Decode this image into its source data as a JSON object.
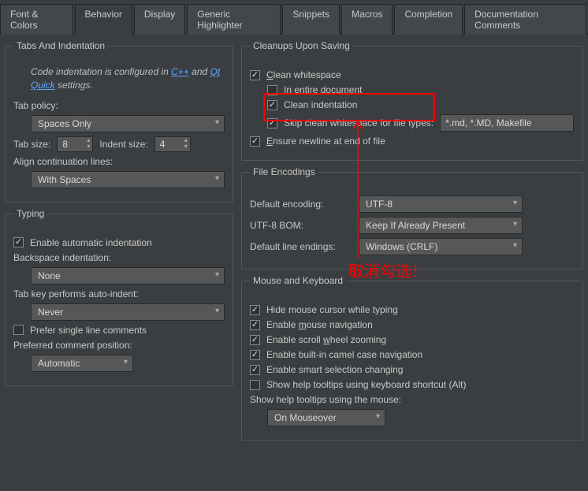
{
  "tabs": {
    "font_colors": "Font & Colors",
    "behavior": "Behavior",
    "display": "Display",
    "generic_highlighter": "Generic Highlighter",
    "snippets": "Snippets",
    "macros": "Macros",
    "completion": "Completion",
    "doc_comments": "Documentation Comments"
  },
  "groups": {
    "tabs_indent": {
      "title": "Tabs And Indentation",
      "hint_prefix": "Code indentation is configured in ",
      "hint_link1": "C++",
      "hint_mid": " and ",
      "hint_link2": "Qt Quick",
      "hint_suffix": " settings.",
      "tab_policy_label": "Tab policy:",
      "tab_policy_value": "Spaces Only",
      "tab_size_label": "Tab size:",
      "tab_size_value": "8",
      "indent_size_label": "Indent size:",
      "indent_size_value": "4",
      "align_label": "Align continuation lines:",
      "align_value": "With Spaces"
    },
    "typing": {
      "title": "Typing",
      "auto_indent": "Enable automatic indentation",
      "backspace_label": "Backspace indentation:",
      "backspace_value": "None",
      "tabkey_label": "Tab key performs auto-indent:",
      "tabkey_value": "Never",
      "singleline": "Prefer single line comments",
      "commentpos_label": "Preferred comment position:",
      "commentpos_value": "Automatic"
    },
    "cleanups": {
      "title": "Cleanups Upon Saving",
      "clean_ws": "Clean whitespace",
      "entire_doc": "In entire document",
      "clean_indent": "Clean indentation",
      "skip_types_label": "Skip clean whitespace for file types:",
      "skip_types_value": "*.md, *.MD, Makefile",
      "newline": "Ensure newline at end of file"
    },
    "encodings": {
      "title": "File Encodings",
      "default_enc_label": "Default encoding:",
      "default_enc_value": "UTF-8",
      "bom_label": "UTF-8 BOM:",
      "bom_value": "Keep If Already Present",
      "line_end_label": "Default line endings:",
      "line_end_value": "Windows (CRLF)"
    },
    "mouse": {
      "title": "Mouse and Keyboard",
      "hide_cursor": "Hide mouse cursor while typing",
      "mouse_nav": "Enable mouse navigation",
      "scroll_zoom": "Enable scroll wheel zooming",
      "camel": "Enable built-in camel case navigation",
      "smart_sel": "Enable smart selection changing",
      "tooltips_alt": "Show help tooltips using keyboard shortcut (Alt)",
      "tooltips_mouse_label": "Show help tooltips using the mouse:",
      "tooltips_mouse_value": "On Mouseover"
    }
  },
  "annotation": "取消勾选！"
}
